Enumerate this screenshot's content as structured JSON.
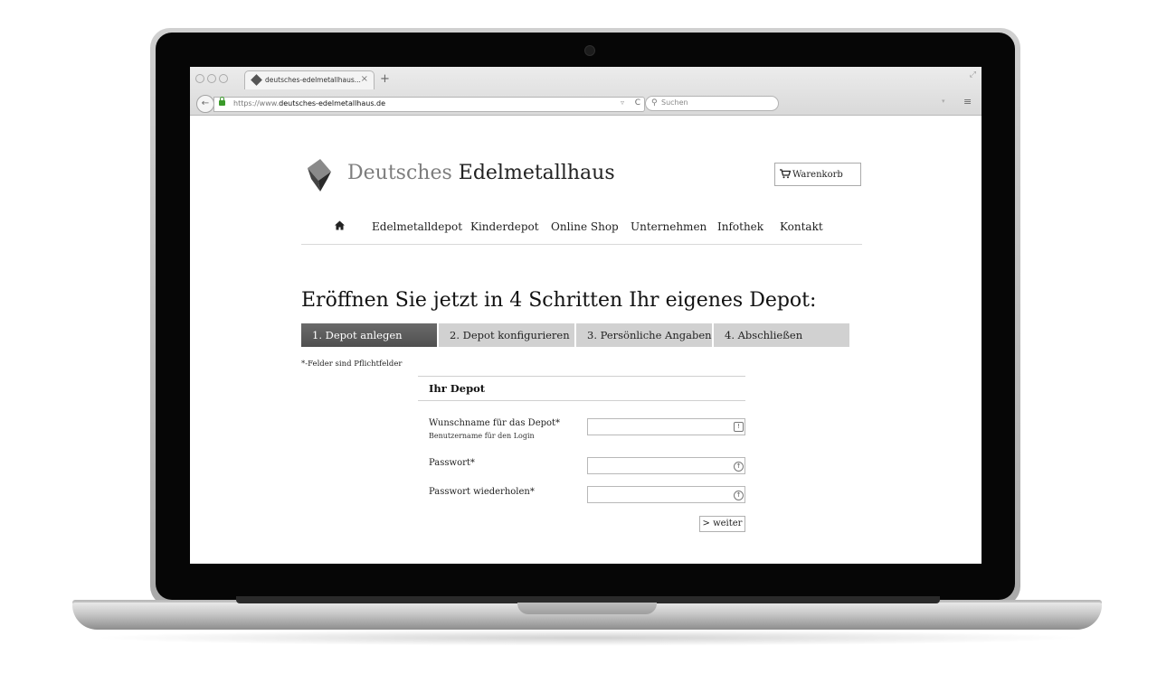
{
  "browser": {
    "tab_title": "deutsches-edelmetallhaus...",
    "tab_close": "×",
    "new_tab": "+",
    "url_prefix": "https://www.",
    "url_domain": "deutsches-edelmetallhaus.de",
    "search_placeholder": "Suchen",
    "reload_glyph": "C",
    "menu_glyph": "≡",
    "back_glyph": "←"
  },
  "site": {
    "logo_word1": "Deutsches",
    "logo_word2": "Edelmetallhaus",
    "cart_label": "Warenkorb",
    "cart_icon": "cart-icon",
    "nav": [
      {
        "label": "Edelmetalldepot"
      },
      {
        "label": "Kinderdepot"
      },
      {
        "label": "Online Shop"
      },
      {
        "label": "Unternehmen"
      },
      {
        "label": "Infothek"
      },
      {
        "label": "Kontakt"
      }
    ]
  },
  "main": {
    "headline": "Eröffnen Sie jetzt in 4 Schritten Ihr eigenes Depot:",
    "steps": [
      {
        "label": "1. Depot anlegen",
        "active": true
      },
      {
        "label": "2. Depot konfigurieren",
        "active": false
      },
      {
        "label": "3. Persönliche Angaben",
        "active": false
      },
      {
        "label": "4. Abschließen",
        "active": false
      }
    ],
    "required_note": "*-Felder sind Pflichtfelder",
    "form": {
      "title": "Ihr Depot",
      "fields": [
        {
          "label": "Wunschname für das Depot*",
          "hint": "Benutzername für den Login",
          "value": ""
        },
        {
          "label": "Passwort*",
          "value": ""
        },
        {
          "label": "Passwort wiederholen*",
          "value": ""
        }
      ],
      "next_label": "> weiter"
    }
  },
  "colors": {
    "active_step": "#5a5a5a",
    "inactive_step": "#d1d1d1",
    "lock_green": "#3a9a2a"
  }
}
